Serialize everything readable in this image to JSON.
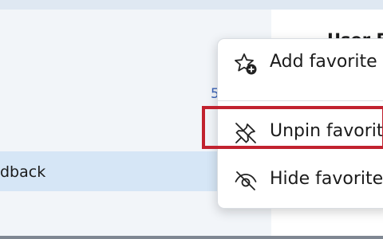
{
  "left_panel": {
    "feedback_label": "dback",
    "link_number": "5"
  },
  "right_panel": {
    "title": "User F"
  },
  "context_menu": {
    "items": [
      {
        "label": "Add favorite",
        "icon": "star-add-icon"
      },
      {
        "label": "Unpin favorite",
        "icon": "pin-off-icon"
      },
      {
        "label": "Hide favorites",
        "icon": "eye-off-icon"
      }
    ],
    "highlighted_index": 1
  },
  "colors": {
    "highlight": "#c1222f",
    "selected_row": "#d6e6f6",
    "link": "#3a63b8"
  }
}
